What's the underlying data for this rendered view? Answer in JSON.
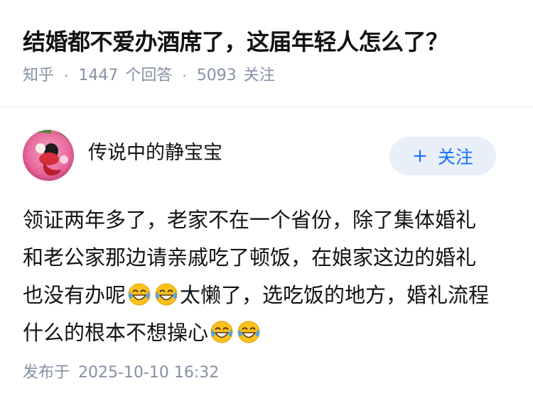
{
  "question": {
    "title": "结婚都不爱办酒席了，这届年轻人怎么了？",
    "source": "知乎",
    "answers_count": "1447",
    "answers_label": "个回答",
    "followers_count": "5093",
    "followers_label": "关注"
  },
  "author": {
    "name": "传说中的静宝宝",
    "follow_icon": "+",
    "follow_label": "关注"
  },
  "answer": {
    "lines": [
      {
        "text": "领证两年多了，老家不在一个省份，除了集体婚礼"
      },
      {
        "text": "和老公家那边请亲戚吃了顿饭，在娘家这边的婚礼"
      },
      {
        "pre": "也没有办呢",
        "emoji_count": 2,
        "post": "太懒了，选吃饭的地方，婚礼流程"
      },
      {
        "pre": "什么的根本不想操心",
        "emoji_count": 2
      }
    ],
    "emoji_name": "laugh-cry-emoji"
  },
  "publish": {
    "label": "发布于",
    "datetime": "2025-10-10 16:32"
  },
  "colors": {
    "title": "#121212",
    "meta": "#8590a6",
    "follow_bg": "#e8eff8",
    "follow_text": "#1772f6",
    "divider": "#ebebeb"
  }
}
